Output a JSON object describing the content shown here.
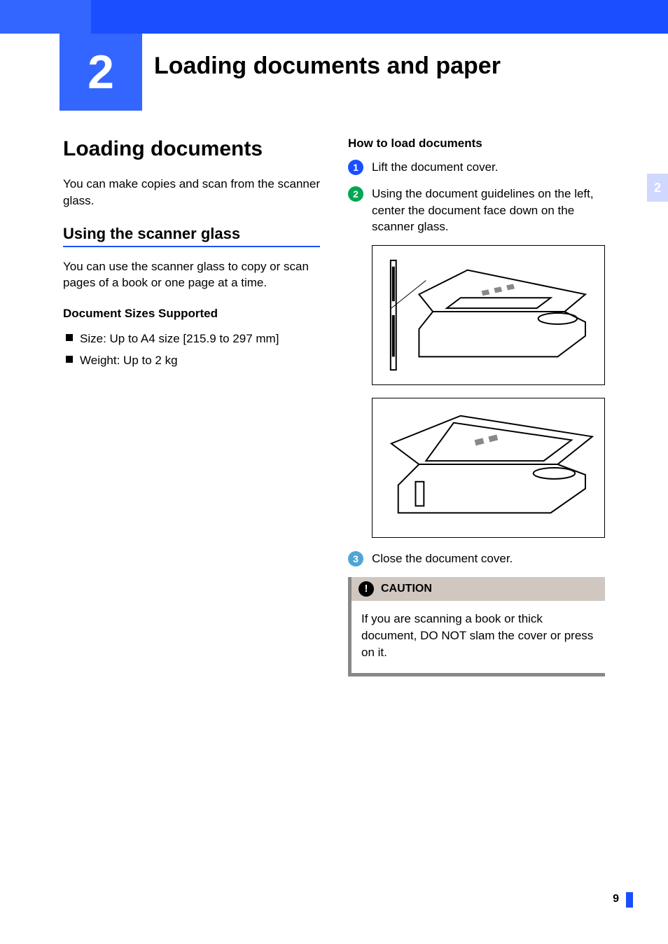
{
  "chapter": {
    "number": "2",
    "title": "Loading documents and paper"
  },
  "tab": {
    "label": "2"
  },
  "left": {
    "h1": "Loading documents",
    "intro": "You can make copies and scan from the scanner glass.",
    "h2": "Using the scanner glass",
    "desc": "You can use the scanner glass to copy or scan pages of a book or one page at a time.",
    "h3": "Document Sizes Supported",
    "bullets": [
      "Size: Up to A4 size [215.9 to 297 mm]",
      "Weight: Up to 2 kg"
    ]
  },
  "right": {
    "h3": "How to load documents",
    "steps": [
      {
        "n": "1",
        "text": "Lift the document cover."
      },
      {
        "n": "2",
        "text": "Using the document guidelines on the left, center the document face down on the scanner glass."
      },
      {
        "n": "3",
        "text": "Close the document cover."
      }
    ],
    "caution": {
      "label": "CAUTION",
      "text": "If you are scanning a book or thick document, DO NOT slam the cover or press on it."
    }
  },
  "page_number": "9"
}
